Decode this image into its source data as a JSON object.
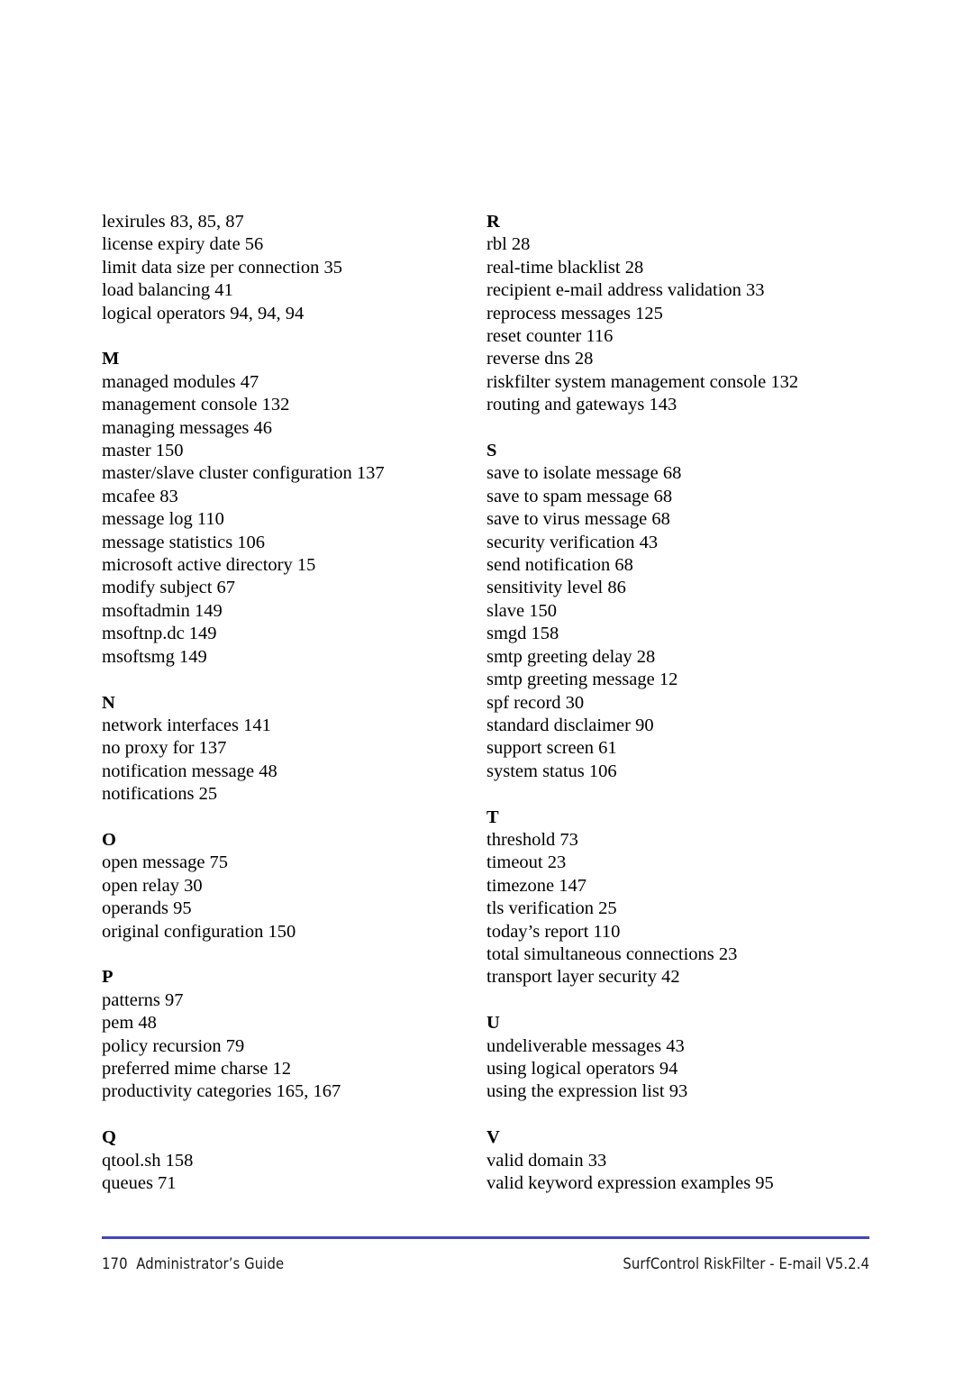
{
  "document": {
    "type": "index-page",
    "page_number": "170",
    "columns": [
      {
        "id": "left",
        "sections": [
          {
            "heading": "",
            "entries": [
              "lexirules 83, 85, 87",
              "license expiry date 56",
              "limit data size per connection 35",
              "load balancing 41",
              "logical operators 94, 94, 94"
            ]
          },
          {
            "heading": "M",
            "entries": [
              "managed modules 47",
              "management console 132",
              "managing messages 46",
              "master 150",
              "master/slave cluster configuration 137",
              "mcafee 83",
              "message log 110",
              "message statistics 106",
              "microsoft active directory 15",
              "modify subject 67",
              "msoftadmin 149",
              "msoftnp.dc 149",
              "msoftsmg 149"
            ]
          },
          {
            "heading": "N",
            "entries": [
              "network interfaces 141",
              "no proxy for 137",
              "notification message 48",
              "notifications 25"
            ]
          },
          {
            "heading": "O",
            "entries": [
              "open message 75",
              "open relay 30",
              "operands 95",
              "original configuration 150"
            ]
          },
          {
            "heading": "P",
            "entries": [
              "patterns 97",
              "pem 48",
              "policy recursion 79",
              "preferred mime charse 12",
              "productivity categories 165, 167"
            ]
          },
          {
            "heading": "Q",
            "entries": [
              "qtool.sh 158",
              "queues 71"
            ]
          }
        ]
      },
      {
        "id": "right",
        "sections": [
          {
            "heading": "R",
            "entries": [
              "rbl 28",
              "real-time blacklist 28",
              "recipient e-mail address validation 33",
              "reprocess messages 125",
              "reset counter 116",
              "reverse dns 28",
              "riskfilter system management console 132",
              "routing and gateways 143"
            ]
          },
          {
            "heading": "S",
            "entries": [
              "save to isolate message 68",
              "save to spam message 68",
              "save to virus message 68",
              "security verification 43",
              "send notification 68",
              "sensitivity level 86",
              "slave 150",
              "smgd 158",
              "smtp greeting delay 28",
              "smtp greeting message 12",
              "spf record 30",
              "standard disclaimer 90",
              "support screen 61",
              "system status 106"
            ]
          },
          {
            "heading": "T",
            "entries": [
              "threshold 73",
              "timeout 23",
              "timezone 147",
              "tls verification 25",
              "today’s report 110",
              "total simultaneous connections 23",
              "transport layer security 42"
            ]
          },
          {
            "heading": "U",
            "entries": [
              "undeliverable messages 43",
              "using logical operators 94",
              "using the expression list 93"
            ]
          },
          {
            "heading": "V",
            "entries": [
              "valid domain 33",
              "valid keyword expression examples 95"
            ]
          }
        ]
      }
    ],
    "footer": {
      "left": "170  Administrator’s Guide",
      "right": "SurfControl RiskFilter - E-mail V5.2.4",
      "rule_color": "#4146b8"
    }
  }
}
